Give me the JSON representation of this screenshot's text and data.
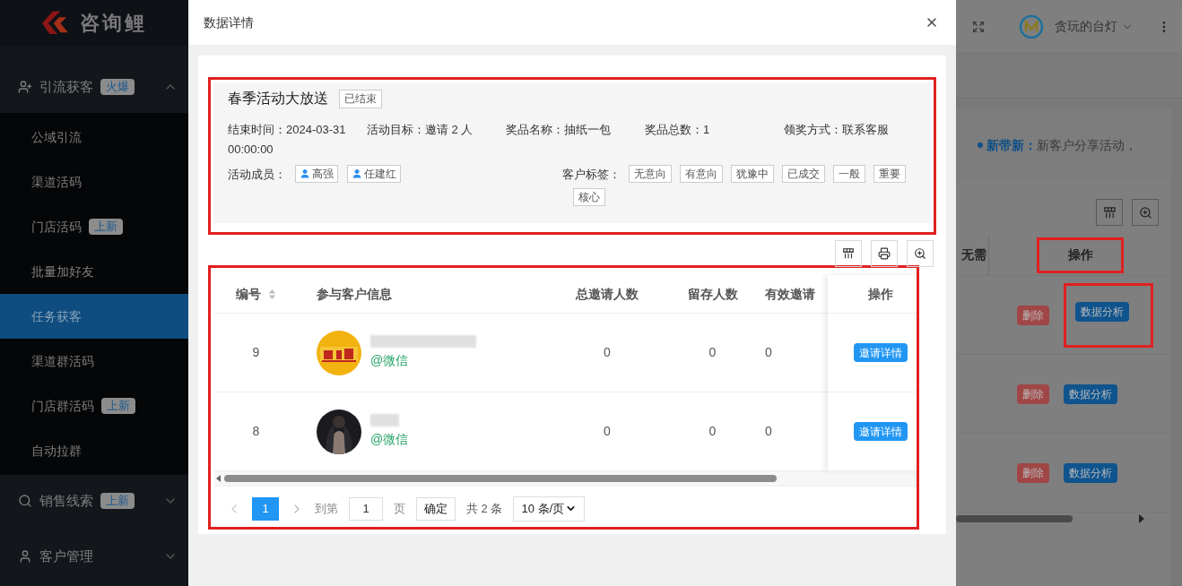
{
  "sidebar": {
    "logo": "咨询鲤",
    "groups": [
      {
        "label": "引流获客",
        "badge": "火爆",
        "expanded": true,
        "items": [
          {
            "label": "公域引流",
            "selected": false
          },
          {
            "label": "渠道活码",
            "selected": false
          },
          {
            "label": "门店活码",
            "badge": "上新",
            "selected": false
          },
          {
            "label": "批量加好友",
            "selected": false
          },
          {
            "label": "任务获客",
            "selected": true
          },
          {
            "label": "渠道群活码",
            "selected": false
          },
          {
            "label": "门店群活码",
            "badge": "上新",
            "selected": false
          },
          {
            "label": "自动拉群",
            "selected": false
          }
        ]
      },
      {
        "label": "销售线索",
        "badge": "上新",
        "expanded": false
      },
      {
        "label": "客户管理",
        "expanded": false
      }
    ]
  },
  "header": {
    "user": "贪玩的台灯"
  },
  "background": {
    "notice_label": "新带新：",
    "notice_text": "新客户分享活动，",
    "partial_column": "无需",
    "action_column": "操作",
    "rows": [
      {
        "delete": "删除",
        "analyze": "数据分析"
      },
      {
        "delete": "删除",
        "analyze": "数据分析"
      },
      {
        "delete": "删除",
        "analyze": "数据分析"
      }
    ]
  },
  "dialog": {
    "title": "数据详情",
    "activity": {
      "name": "春季活动大放送",
      "status": "已结束",
      "fields": [
        {
          "label": "结束时间：",
          "value": "2024-03-31 00:00:00"
        },
        {
          "label": "活动目标：",
          "value": "邀请 2 人"
        },
        {
          "label": "奖品名称：",
          "value": "抽纸一包"
        },
        {
          "label": "奖品总数：",
          "value": "1"
        },
        {
          "label": "领奖方式：",
          "value": "联系客服"
        }
      ],
      "members_label": "活动成员：",
      "members": [
        "高强",
        "任建红"
      ],
      "tags_label": "客户标签：",
      "tags": [
        "无意向",
        "有意向",
        "犹豫中",
        "已成交",
        "一般",
        "重要",
        "核心"
      ]
    },
    "table": {
      "columns": [
        {
          "label": "编号",
          "sortable": true
        },
        {
          "label": "参与客户信息",
          "sortable": false
        },
        {
          "label": "总邀请人数",
          "sortable": false
        },
        {
          "label": "留存人数",
          "sortable": false
        },
        {
          "label": "有效邀请",
          "sortable": false
        },
        {
          "label": "操作",
          "sortable": false
        }
      ],
      "rows": [
        {
          "id": "9",
          "channel": "@微信",
          "total": "0",
          "retained": "0",
          "valid": "0",
          "action": "邀请详情"
        },
        {
          "id": "8",
          "channel": "@微信",
          "total": "0",
          "retained": "0",
          "valid": "0",
          "action": "邀请详情"
        }
      ]
    },
    "pagination": {
      "pages": [
        {
          "label": "1",
          "selected": true
        }
      ],
      "goto_label": "到第",
      "goto_value": "1",
      "page_unit": "页",
      "confirm": "确定",
      "total": "共 2 条",
      "page_size": "10 条/页"
    }
  }
}
